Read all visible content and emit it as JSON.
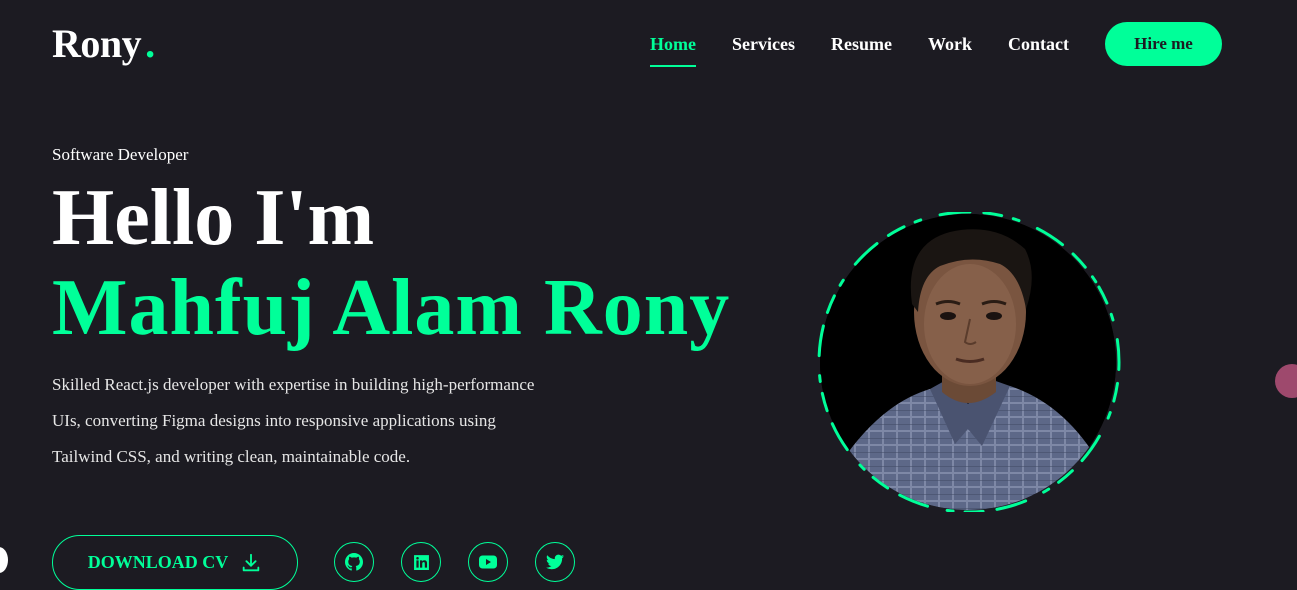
{
  "header": {
    "logo": "Rony",
    "logo_dot": ".",
    "nav": [
      {
        "label": "Home",
        "active": true
      },
      {
        "label": "Services",
        "active": false
      },
      {
        "label": "Resume",
        "active": false
      },
      {
        "label": "Work",
        "active": false
      },
      {
        "label": "Contact",
        "active": false
      }
    ],
    "hire_label": "Hire me"
  },
  "hero": {
    "subtitle": "Software Developer",
    "greeting": "Hello I'm",
    "name": "Mahfuj Alam Rony",
    "description": "Skilled React.js developer with expertise in building high-performance UIs, converting Figma designs into responsive applications using Tailwind CSS, and writing clean, maintainable code.",
    "download_label": "DOWNLOAD CV",
    "socials": [
      {
        "icon": "github-icon"
      },
      {
        "icon": "linkedin-icon"
      },
      {
        "icon": "youtube-icon"
      },
      {
        "icon": "twitter-icon"
      }
    ]
  },
  "colors": {
    "accent": "#00ff99",
    "background": "#1c1b22",
    "text": "#ffffff"
  }
}
